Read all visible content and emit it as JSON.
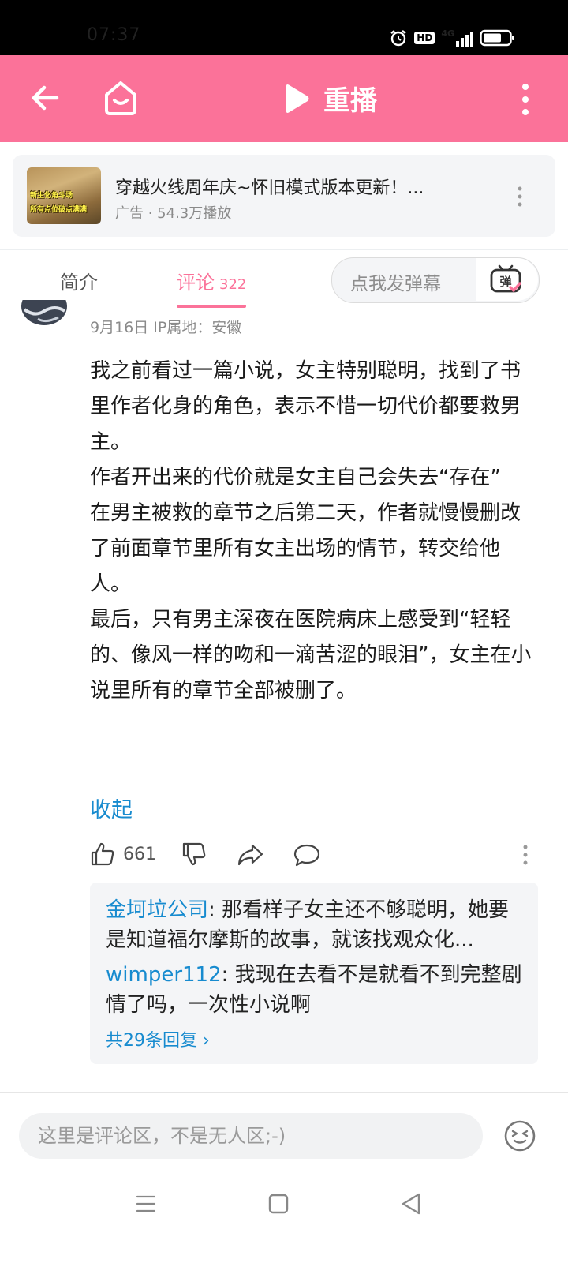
{
  "status_bar": {
    "time": "07:37",
    "icons": [
      "alarm-icon",
      "hd-icon",
      "4g-signal-icon",
      "battery-icon"
    ],
    "hd_label": "HD",
    "network_label": "4G"
  },
  "top_bar": {
    "back_icon": "arrow-left-icon",
    "home_icon": "home-face-icon",
    "replay_label": "重播",
    "more_icon": "more-vertical-icon",
    "background": "#fb7299"
  },
  "ad": {
    "title": "穿越火线周年庆~怀旧模式版本更新！...",
    "meta": "广告 · 54.3万播放",
    "thumb_text_1": "新生化角斗场",
    "thumb_text_2": "所有点位破点满满"
  },
  "tabs": {
    "intro_label": "简介",
    "comments_label": "评论",
    "comments_count": "322",
    "danmaku_placeholder": "点我发弹幕",
    "danmaku_icon_label": "弹"
  },
  "comment": {
    "meta": "9月16日 IP属地：安徽",
    "body": [
      "我之前看过一篇小说，女主特别聪明，找到了书里作者化身的角色，表示不惜一切代价都要救男主。",
      "作者开出来的代价就是女主自己会失去“存在”",
      "在男主被救的章节之后第二天，作者就慢慢删改了前面章节里所有女主出场的情节，转交给他人。",
      "最后，只有男主深夜在医院病床上感受到“轻轻的、像风一样的吻和一滴苦涩的眼泪”，女主在小说里所有的章节全部被删了。"
    ],
    "collapse_label": "收起",
    "like_count": "661"
  },
  "replies": [
    {
      "user": "金坷垃公司",
      "text": ": 那看样子女主还不够聪明，她要是知道福尔摩斯的故事，就该找观众化..."
    },
    {
      "user": "wimper112",
      "text": ": 我现在去看不是就看不到完整剧情了吗，一次性小说啊"
    }
  ],
  "reply_total": "共29条回复 ›",
  "input": {
    "placeholder": "这里是评论区，不是无人区;-)"
  },
  "colors": {
    "accent": "#fb7299",
    "link": "#178bcf"
  }
}
